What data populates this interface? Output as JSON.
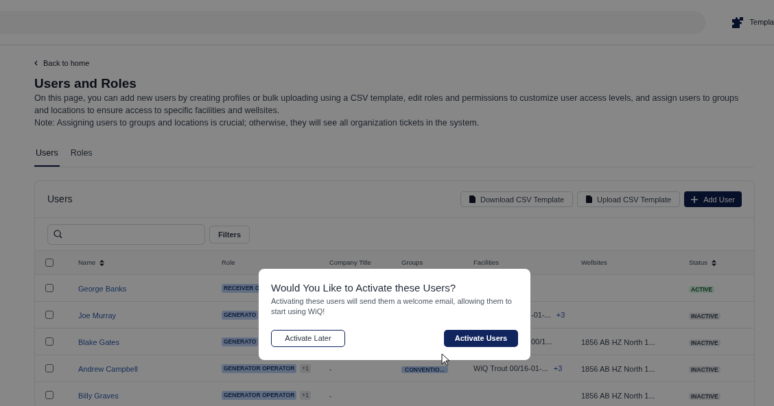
{
  "top_bar": {
    "link": "Templa"
  },
  "back_link": "Back to home",
  "page_title": "Users and Roles",
  "description": [
    "On this page, you can add new users by creating profiles or bulk uploading using a CSV template, edit roles and permissions to customize user access levels, and assign users to groups and locations to ensure access to specific facilities and wellsites.",
    "Note: Assigning users to groups and locations is crucial; otherwise, they will see all organization tickets in the system."
  ],
  "tabs": [
    {
      "label": "Users",
      "selected": true
    },
    {
      "label": "Roles",
      "selected": false
    }
  ],
  "card": {
    "title": "Users",
    "buttons": [
      {
        "label": "Download CSV Template",
        "kind": "file"
      },
      {
        "label": "Upload CSV Template",
        "kind": "file"
      },
      {
        "label": "Add User",
        "kind": "primary"
      }
    ],
    "filters_button": "Filters",
    "select_all": {
      "checked": false
    },
    "columns": [
      {
        "label": "Name",
        "sortable": true
      },
      {
        "label": "Role",
        "sortable": false
      },
      {
        "label": "Company Title",
        "sortable": false
      },
      {
        "label": "Groups",
        "sortable": false
      },
      {
        "label": "Facilities",
        "sortable": false
      },
      {
        "label": "Wellsites",
        "sortable": false
      },
      {
        "label": "Status",
        "sortable": true
      }
    ],
    "rows": [
      {
        "selected": false,
        "name": "George Banks",
        "role": "RECEIVER O",
        "status": "ACTIVE",
        "active": true
      },
      {
        "selected": false,
        "name": "Joe Murray",
        "role": "GENERATO",
        "facility": "-01-...",
        "facility_extra": "+3",
        "status": "INACTIVE",
        "active": false
      },
      {
        "selected": false,
        "name": "Blake Gates",
        "role": "GENERATO",
        "facility": "00/1...",
        "wellsite": "1856 AB HZ North 1...",
        "status": "INACTIVE",
        "active": false
      },
      {
        "selected": false,
        "name": "Andrew Campbell",
        "role": "GENERATOR OPERATOR",
        "role_extra": "+1",
        "company_title": "-",
        "group": "CONVENTIO...",
        "facility": "WiQ Trout 00/16-01-...",
        "facility_extra": "+3",
        "wellsite": "1856 AB HZ North 1...",
        "status": "INACTIVE",
        "active": false
      },
      {
        "selected": false,
        "name": "Billy Graves",
        "role": "GENERATOR OPERATOR",
        "role_extra": "+1",
        "company_title": "-",
        "wellsite": "1856 AB HZ North 1...",
        "status": "INACTIVE",
        "active": false
      }
    ]
  },
  "dialog": {
    "title": "Would You Like to Activate these Users?",
    "message": "Activating these users will send them a welcome email, allowing them to start using WiQ!",
    "buttons": [
      {
        "label": "Activate Later",
        "kind": "secondary"
      },
      {
        "label": "Activate Users",
        "kind": "primary"
      }
    ]
  }
}
